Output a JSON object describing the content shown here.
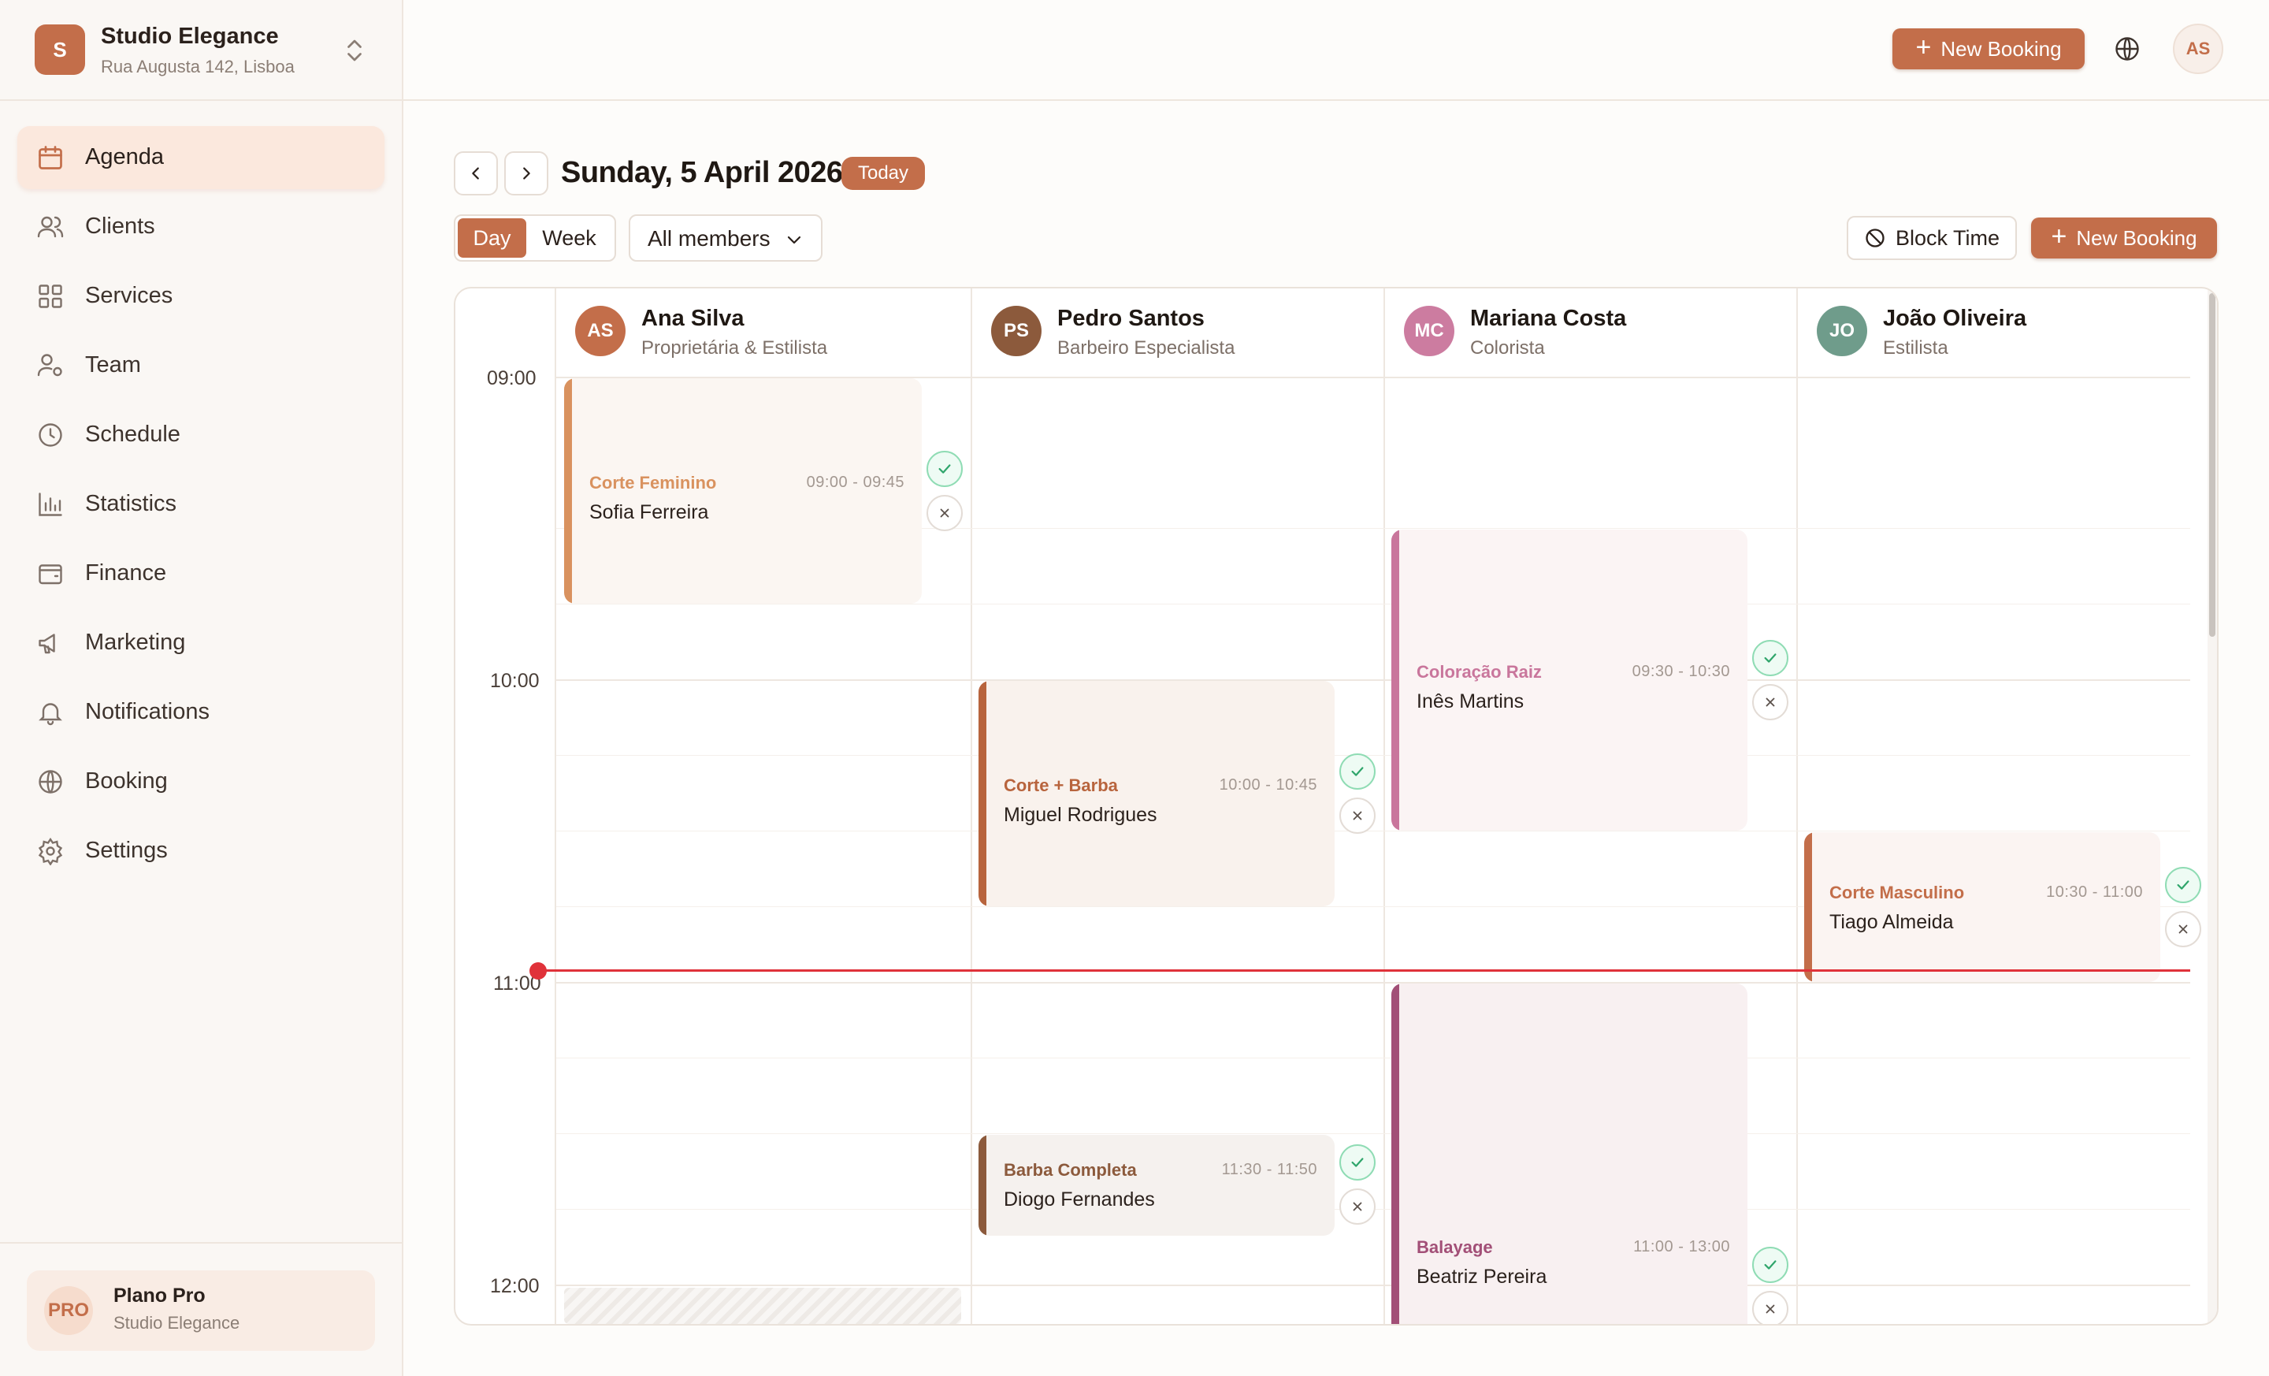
{
  "brand": {
    "logo_letter": "S",
    "name": "Studio Elegance",
    "address": "Rua Augusta 142, Lisboa"
  },
  "sidebar": {
    "items": [
      {
        "label": "Agenda",
        "icon": "calendar-icon",
        "active": true
      },
      {
        "label": "Clients",
        "icon": "users-icon"
      },
      {
        "label": "Services",
        "icon": "grid-icon"
      },
      {
        "label": "Team",
        "icon": "user-gear-icon"
      },
      {
        "label": "Schedule",
        "icon": "clock-icon"
      },
      {
        "label": "Statistics",
        "icon": "bar-chart-icon"
      },
      {
        "label": "Finance",
        "icon": "wallet-icon"
      },
      {
        "label": "Marketing",
        "icon": "megaphone-icon"
      },
      {
        "label": "Notifications",
        "icon": "bell-icon"
      },
      {
        "label": "Booking",
        "icon": "globe-icon"
      },
      {
        "label": "Settings",
        "icon": "gear-icon"
      }
    ],
    "plan": {
      "badge": "PRO",
      "name": "Plano Pro",
      "studio": "Studio Elegance"
    }
  },
  "topbar": {
    "new_booking": "New Booking",
    "avatar": "AS"
  },
  "toolbar": {
    "date": "Sunday, 5 April 2026",
    "today": "Today",
    "view_day": "Day",
    "view_week": "Week",
    "members_filter": "All members",
    "block_time": "Block Time",
    "new_booking": "New Booking"
  },
  "calendar": {
    "times": [
      "09:00",
      "10:00",
      "11:00",
      "12:00"
    ],
    "members": [
      {
        "initials": "AS",
        "name": "Ana Silva",
        "role": "Proprietária & Estilista",
        "color": "#c36e4a"
      },
      {
        "initials": "PS",
        "name": "Pedro Santos",
        "role": "Barbeiro Especialista",
        "color": "#8c5a3c"
      },
      {
        "initials": "MC",
        "name": "Mariana Costa",
        "role": "Colorista",
        "color": "#cc7ca0"
      },
      {
        "initials": "JO",
        "name": "João Oliveira",
        "role": "Estilista",
        "color": "#6f9c8b"
      }
    ],
    "appointments": [
      {
        "service": "Corte Feminino",
        "time": "09:00 - 09:45",
        "client": "Sofia Ferreira",
        "color": "#d9925f"
      },
      {
        "service": "Corte + Barba",
        "time": "10:00 - 10:45",
        "client": "Miguel Rodrigues",
        "color": "#b8643d"
      },
      {
        "service": "Barba Completa",
        "time": "11:30 - 11:50",
        "client": "Diogo Fernandes",
        "color": "#8c5a3c"
      },
      {
        "service": "Coloração Raiz",
        "time": "09:30 - 10:30",
        "client": "Inês Martins",
        "color": "#c9769c"
      },
      {
        "service": "Balayage",
        "time": "11:00 - 13:00",
        "client": "Beatriz Pereira",
        "color": "#a24f77"
      },
      {
        "service": "Corte Masculino",
        "time": "10:30 - 11:00",
        "client": "Tiago Almeida",
        "color": "#c36e4a"
      }
    ]
  }
}
